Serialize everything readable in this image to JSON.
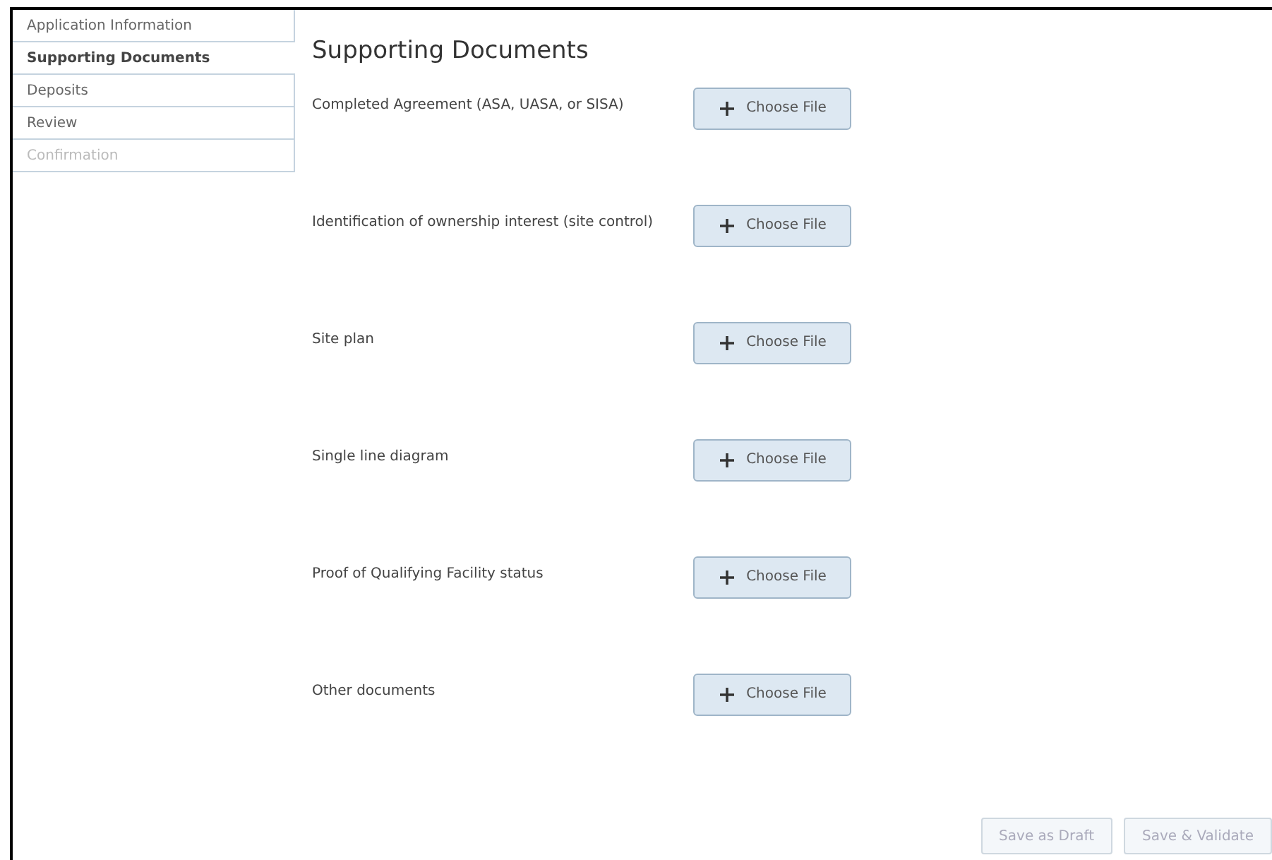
{
  "nav": [
    {
      "label": "Application Information",
      "selected": false,
      "disabled": false
    },
    {
      "label": "Supporting Documents",
      "selected": true,
      "disabled": false
    },
    {
      "label": "Deposits",
      "selected": false,
      "disabled": false
    },
    {
      "label": "Review",
      "selected": false,
      "disabled": false
    },
    {
      "label": "Confirmation",
      "selected": false,
      "disabled": true
    }
  ],
  "title": "Supporting Documents",
  "documents": [
    {
      "label": "Completed Agreement (ASA, UASA, or SISA)",
      "button": "Choose File"
    },
    {
      "label": "Identification of ownership interest (site control)",
      "button": "Choose File"
    },
    {
      "label": "Site plan",
      "button": "Choose File"
    },
    {
      "label": "Single line diagram",
      "button": "Choose File"
    },
    {
      "label": "Proof of Qualifying Facility status",
      "button": "Choose File"
    },
    {
      "label": "Other documents",
      "button": "Choose File"
    }
  ],
  "actions": [
    {
      "label": "Save as Draft",
      "disabled": true
    },
    {
      "label": "Save & Validate",
      "disabled": true
    }
  ]
}
